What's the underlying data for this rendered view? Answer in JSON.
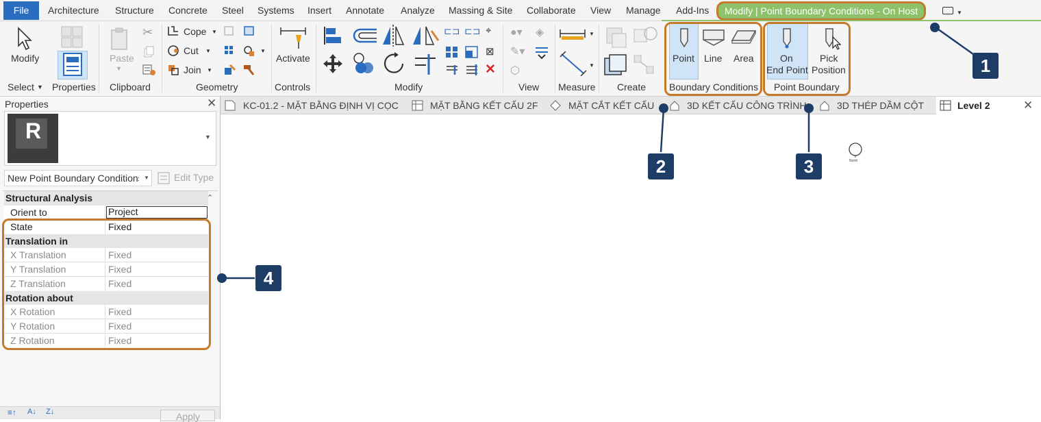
{
  "menu": {
    "file": "File",
    "items": [
      "Architecture",
      "Structure",
      "Concrete",
      "Steel",
      "Systems",
      "Insert",
      "Annotate",
      "Analyze",
      "Massing & Site",
      "Collaborate",
      "View",
      "Manage",
      "Add-Ins"
    ],
    "context_tab": "Modify | Point Boundary Conditions - On Host"
  },
  "ribbon": {
    "select": {
      "modify": "Modify",
      "title": "Select"
    },
    "properties": {
      "title": "Properties"
    },
    "clipboard": {
      "paste": "Paste",
      "title": "Clipboard"
    },
    "geometry": {
      "cope": "Cope",
      "cut": "Cut",
      "join": "Join",
      "title": "Geometry"
    },
    "controls": {
      "activate": "Activate",
      "title": "Controls"
    },
    "modify": {
      "title": "Modify"
    },
    "view": {
      "title": "View"
    },
    "measure": {
      "title": "Measure"
    },
    "create": {
      "title": "Create"
    },
    "boundary_conditions": {
      "point": "Point",
      "line": "Line",
      "area": "Area",
      "title": "Boundary Conditions"
    },
    "point_boundary": {
      "on_end_point_1": "On",
      "on_end_point_2": "End Point",
      "pick_position_1": "Pick",
      "pick_position_2": "Position",
      "title": "Point Boundary"
    }
  },
  "view_tabs": [
    "KC-01.2 - MẶT BẰNG ĐỊNH VỊ CỌC",
    "MẶT BẰNG KẾT CẤU 2F",
    "MẶT CẮT KẾT CẤU",
    "3D KẾT CẤU CÔNG TRÌNH",
    "3D THÉP DẦM CỘT",
    "Level 2"
  ],
  "properties": {
    "header": "Properties",
    "type_logo": "R",
    "type_selector": "New Point Boundary Conditions",
    "edit_type": "Edit Type",
    "group_structural": "Structural Analysis",
    "orient_to_label": "Orient to",
    "orient_to_value": "Project",
    "state_label": "State",
    "state_value": "Fixed",
    "group_translation": "Translation in",
    "x_translation": "X Translation",
    "y_translation": "Y Translation",
    "z_translation": "Z Translation",
    "group_rotation": "Rotation about",
    "x_rotation": "X Rotation",
    "y_rotation": "Y Rotation",
    "z_rotation": "Z Rotation",
    "fixed": "Fixed",
    "apply": "Apply"
  },
  "canvas": {
    "north_label": "North"
  },
  "callouts": [
    "1",
    "2",
    "3",
    "4"
  ],
  "colors": {
    "accent_blue": "#2a6cbf",
    "context_green": "#8dc26a",
    "callout_orange": "#c47a2a",
    "callout_navy": "#1e3d66"
  }
}
